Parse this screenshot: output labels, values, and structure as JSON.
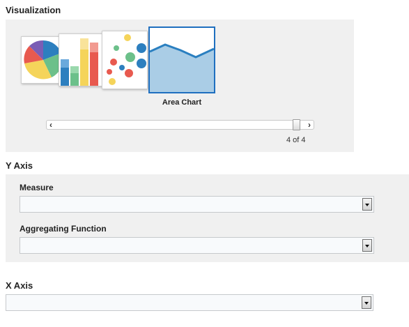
{
  "visualization": {
    "title": "Visualization",
    "selected_caption": "Area Chart",
    "page_indicator": "4 of 4",
    "thumbnails": [
      {
        "icon": "pie-chart-icon"
      },
      {
        "icon": "bar-chart-icon"
      },
      {
        "icon": "bubble-chart-icon"
      },
      {
        "icon": "area-chart-icon",
        "selected": true
      }
    ],
    "slider_position": 1.0,
    "accent_color": "#1f6fbf"
  },
  "y_axis": {
    "title": "Y Axis",
    "measure_label": "Measure",
    "measure_value": "",
    "aggregating_label": "Aggregating Function",
    "aggregating_value": ""
  },
  "x_axis": {
    "title": "X Axis",
    "value": ""
  }
}
